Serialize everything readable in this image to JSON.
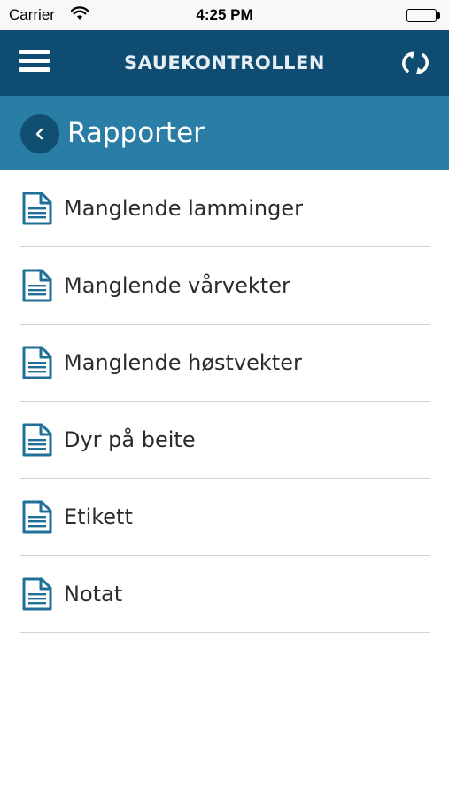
{
  "status_bar": {
    "carrier": "Carrier",
    "time": "4:25 PM"
  },
  "navbar": {
    "title": "SAUEKONTROLLEN",
    "menu_icon": "hamburger-menu-icon",
    "sync_icon": "sync-icon",
    "color": "#0e4d71"
  },
  "header": {
    "title": "Rapporter",
    "back_icon": "chevron-left-icon",
    "color": "#2a7ea5"
  },
  "reports": [
    {
      "label": "Manglende lamminger",
      "icon": "document-icon"
    },
    {
      "label": "Manglende vårvekter",
      "icon": "document-icon"
    },
    {
      "label": "Manglende høstvekter",
      "icon": "document-icon"
    },
    {
      "label": "Dyr på beite",
      "icon": "document-icon"
    },
    {
      "label": "Etikett",
      "icon": "document-icon"
    },
    {
      "label": "Notat",
      "icon": "document-icon"
    }
  ],
  "colors": {
    "icon": "#1f6f99",
    "divider": "#c9d6de",
    "text": "#2b2b2b"
  }
}
